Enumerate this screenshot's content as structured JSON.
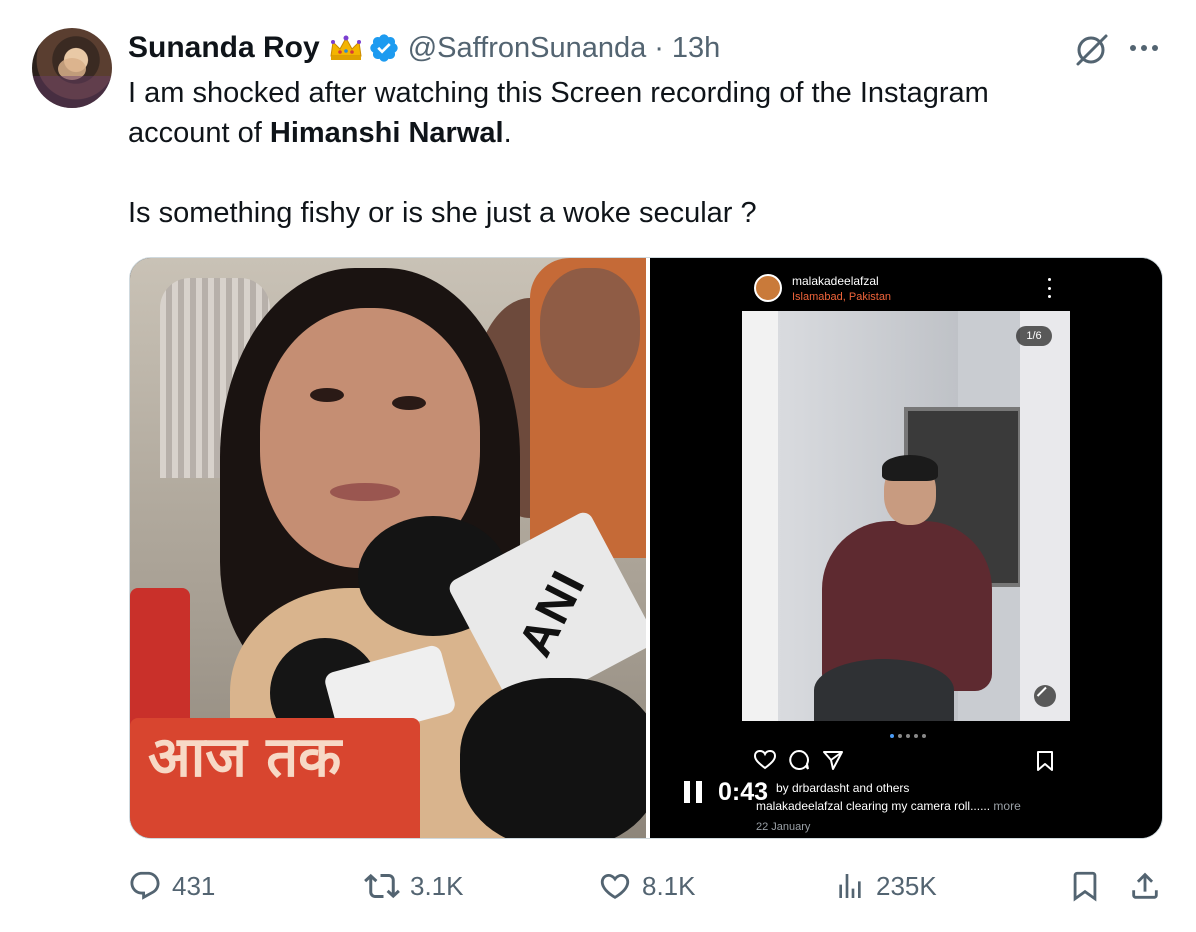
{
  "tweet": {
    "author_name": "Sunanda Roy",
    "handle": "@SaffronSunanda",
    "separator": "·",
    "time": "13h",
    "line1": "I am shocked after watching this Screen recording of the Instagram",
    "line2_prefix": "account of ",
    "line2_bold": "Himanshi Narwal",
    "line2_suffix": ".",
    "line3": "Is something fishy or is she just a woke secular ?"
  },
  "media": {
    "left_overlay": {
      "mic_brand": "ANI",
      "channel_logo": "आज तक"
    },
    "instagram": {
      "username": "malakadeelafzal",
      "location": "Islamabad, Pakistan",
      "counter": "1/6",
      "liked_by": "by drbardasht and others",
      "caption_user": "malakadeelafzal",
      "caption_text": " clearing my camera roll......",
      "caption_more": " more",
      "date": "22 January"
    },
    "video": {
      "duration": "0:43"
    }
  },
  "stats": {
    "replies": "431",
    "retweets": "3.1K",
    "likes": "8.1K",
    "views": "235K"
  },
  "icons": {
    "crown": "crown-emoji-icon",
    "verified": "verified-badge-icon",
    "grok": "grok-icon",
    "more": "more-icon",
    "reply": "reply-icon",
    "retweet": "retweet-icon",
    "like": "heart-icon",
    "views": "views-bar-icon",
    "bookmark": "bookmark-icon",
    "share": "share-icon"
  },
  "colors": {
    "verified": "#1d9bf0",
    "secondary_text": "#536471",
    "ig_location": "#f0643a"
  }
}
